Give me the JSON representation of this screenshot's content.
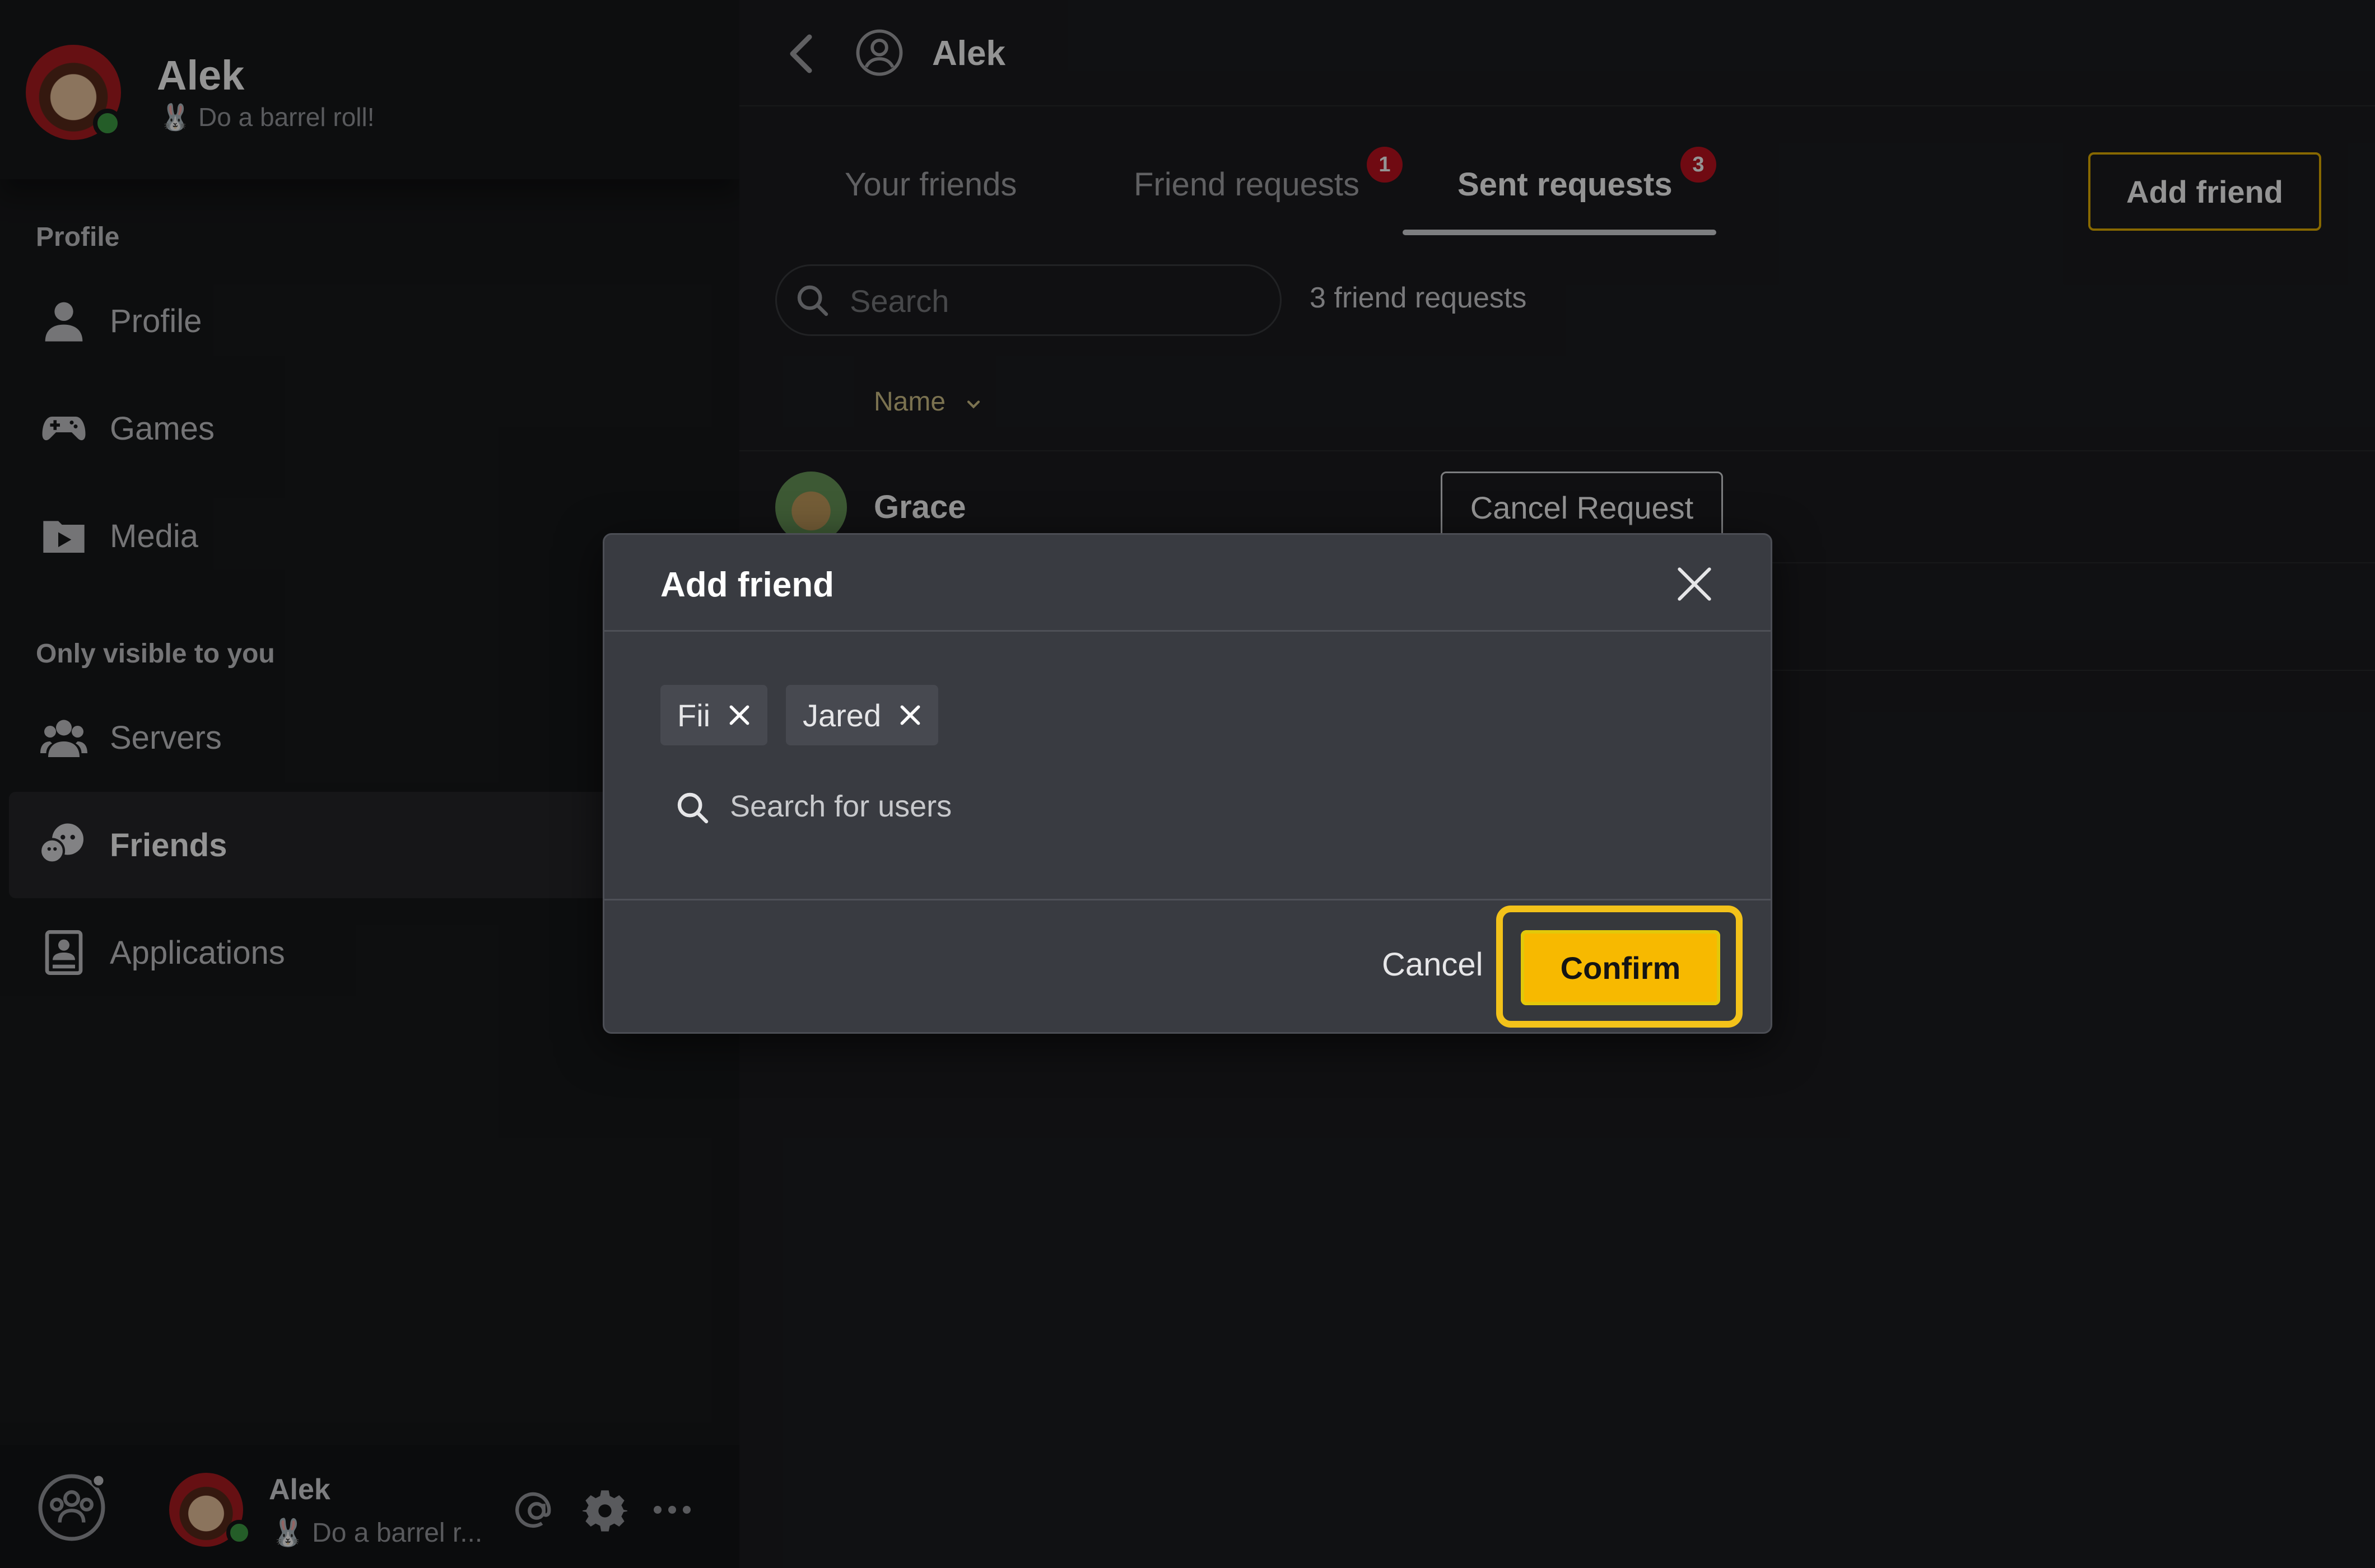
{
  "sidebar": {
    "user": {
      "name": "Alek",
      "status": "🐰 Do a barrel roll!"
    },
    "sections": [
      {
        "label": "Profile"
      },
      {
        "label": "Only visible to you"
      }
    ],
    "items": [
      {
        "label": "Profile",
        "icon": "person-icon"
      },
      {
        "label": "Games",
        "icon": "gamepad-icon"
      },
      {
        "label": "Media",
        "icon": "media-icon"
      },
      {
        "label": "Servers",
        "icon": "servers-icon"
      },
      {
        "label": "Friends",
        "icon": "friends-icon",
        "active": true
      },
      {
        "label": "Applications",
        "icon": "applications-icon"
      }
    ],
    "bottom": {
      "name": "Alek",
      "status": "🐰 Do a barrel r..."
    }
  },
  "header": {
    "title": "Alek"
  },
  "tabs": [
    {
      "label": "Your friends"
    },
    {
      "label": "Friend requests",
      "badge": "1"
    },
    {
      "label": "Sent requests",
      "badge": "3",
      "active": true
    }
  ],
  "add_friend_label": "Add friend",
  "search": {
    "placeholder": "Search"
  },
  "request_count": "3 friend requests",
  "sort": {
    "label": "Name"
  },
  "rows": [
    {
      "name": "Grace",
      "action": "Cancel Request"
    }
  ],
  "modal": {
    "title": "Add friend",
    "chips": [
      {
        "label": "Fii"
      },
      {
        "label": "Jared"
      }
    ],
    "search_placeholder": "Search for users",
    "cancel_label": "Cancel",
    "confirm_label": "Confirm"
  },
  "colors": {
    "accent": "#f7b900",
    "badge": "#c1121f",
    "online": "#3fa046"
  }
}
